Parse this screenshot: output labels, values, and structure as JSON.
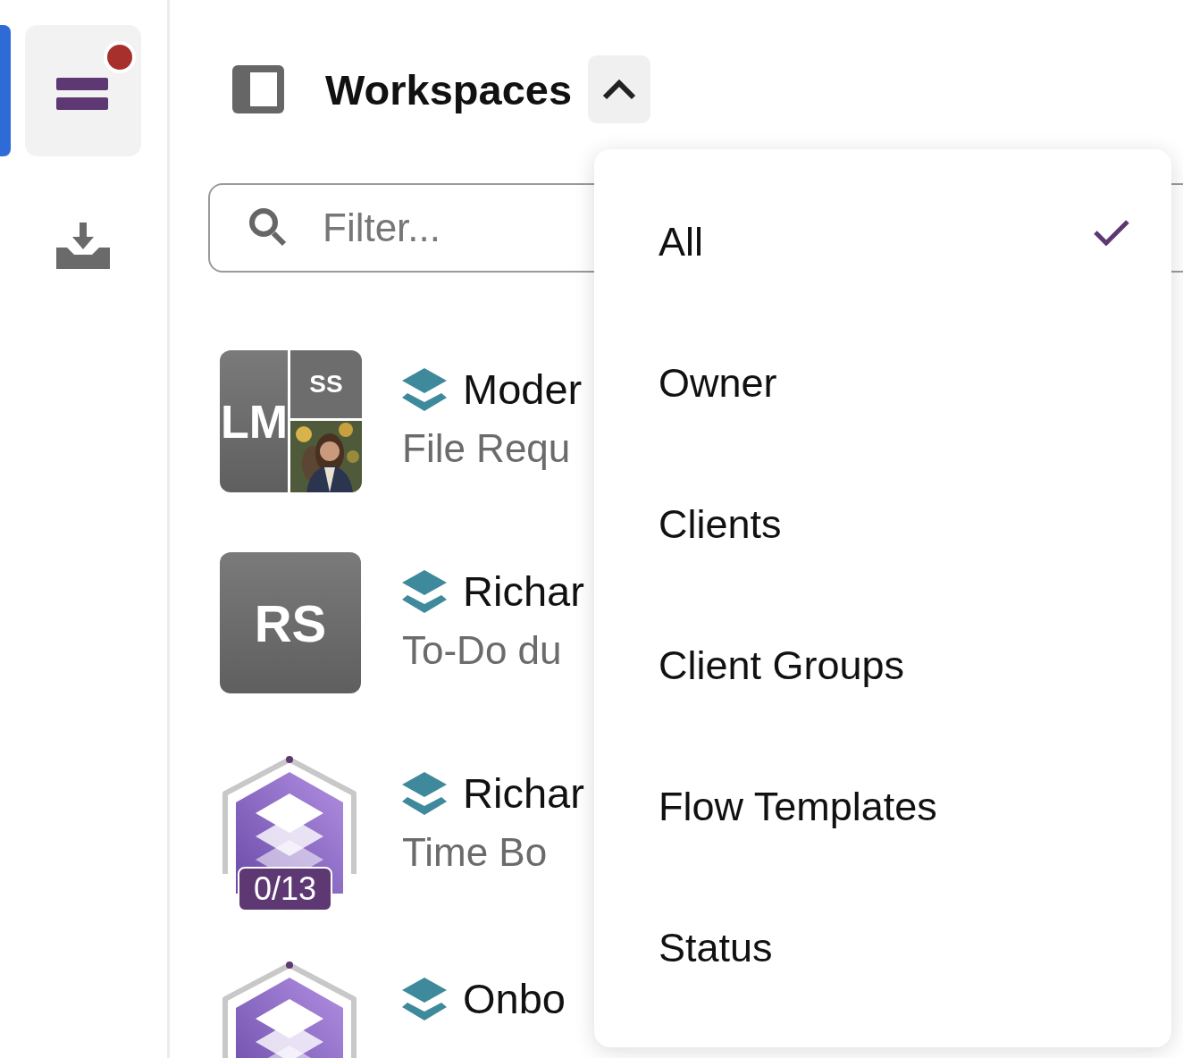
{
  "sidebar": {
    "items": [
      {
        "kind": "inbox-list",
        "selected": true,
        "notification": true
      },
      {
        "kind": "download",
        "selected": false
      }
    ]
  },
  "header": {
    "title": "Workspaces",
    "expanded": true
  },
  "filter": {
    "placeholder": "Filter..."
  },
  "workspaces": [
    {
      "avatar": {
        "kind": "composite",
        "initials": [
          "LM",
          "SS"
        ]
      },
      "title": "Moder",
      "subtitle": "File Requ"
    },
    {
      "avatar": {
        "kind": "initials",
        "initials": [
          "RS"
        ]
      },
      "title": "Richar",
      "subtitle": "To-Do du"
    },
    {
      "avatar": {
        "kind": "progress",
        "badge": "0/13"
      },
      "title": "Richar",
      "subtitle": "Time Bo"
    },
    {
      "avatar": {
        "kind": "progress"
      },
      "title": "Onbo"
    }
  ],
  "menu": {
    "items": [
      {
        "label": "All",
        "selected": true
      },
      {
        "label": "Owner",
        "selected": false
      },
      {
        "label": "Clients",
        "selected": false
      },
      {
        "label": "Client Groups",
        "selected": false
      },
      {
        "label": "Flow Templates",
        "selected": false
      },
      {
        "label": "Status",
        "selected": false
      }
    ]
  }
}
